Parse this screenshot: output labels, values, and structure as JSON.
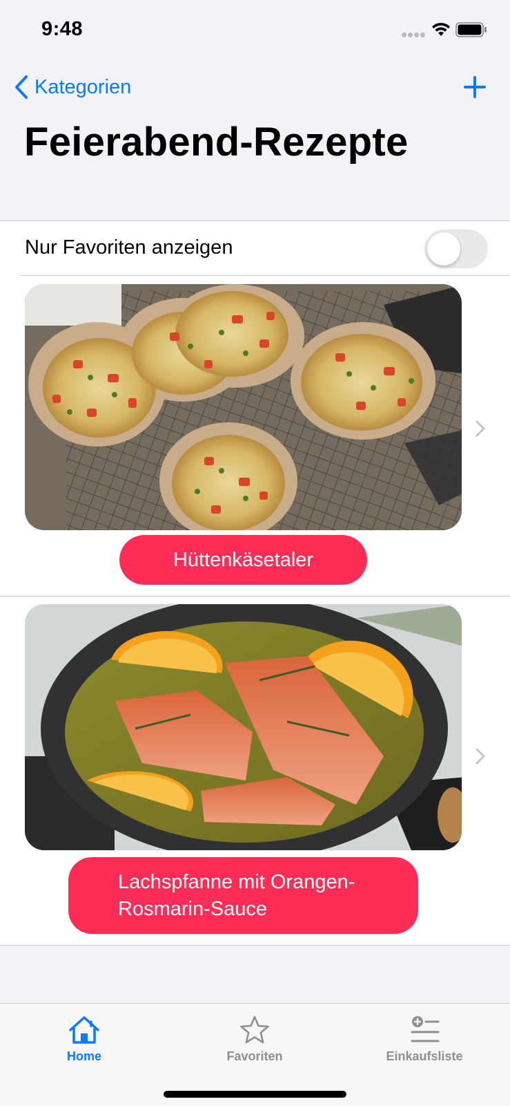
{
  "status_bar": {
    "time": "9:48"
  },
  "nav": {
    "back_label": "Kategorien",
    "title": "Feierabend-Rezepte"
  },
  "filter": {
    "label": "Nur Favoriten anzeigen",
    "enabled": false
  },
  "recipes": [
    {
      "name": "Hüttenkäsetaler",
      "image": "cottage-cheese-patties-photo"
    },
    {
      "name": "Lachspfanne mit Orangen-Rosmarin-Sauce",
      "name_line1": "Lachspfanne mit Orangen-",
      "name_line2": "Rosmarin-Sauce",
      "image": "salmon-pan-photo"
    }
  ],
  "tabs": [
    {
      "label": "Home",
      "icon": "house-icon",
      "active": true
    },
    {
      "label": "Favoriten",
      "icon": "star-icon",
      "active": false
    },
    {
      "label": "Einkaufsliste",
      "icon": "list-add-icon",
      "active": false
    }
  ],
  "colors": {
    "accent": "#0a7aff",
    "recipe_button": "#ff2d55",
    "tab_inactive": "#8e8e93"
  }
}
